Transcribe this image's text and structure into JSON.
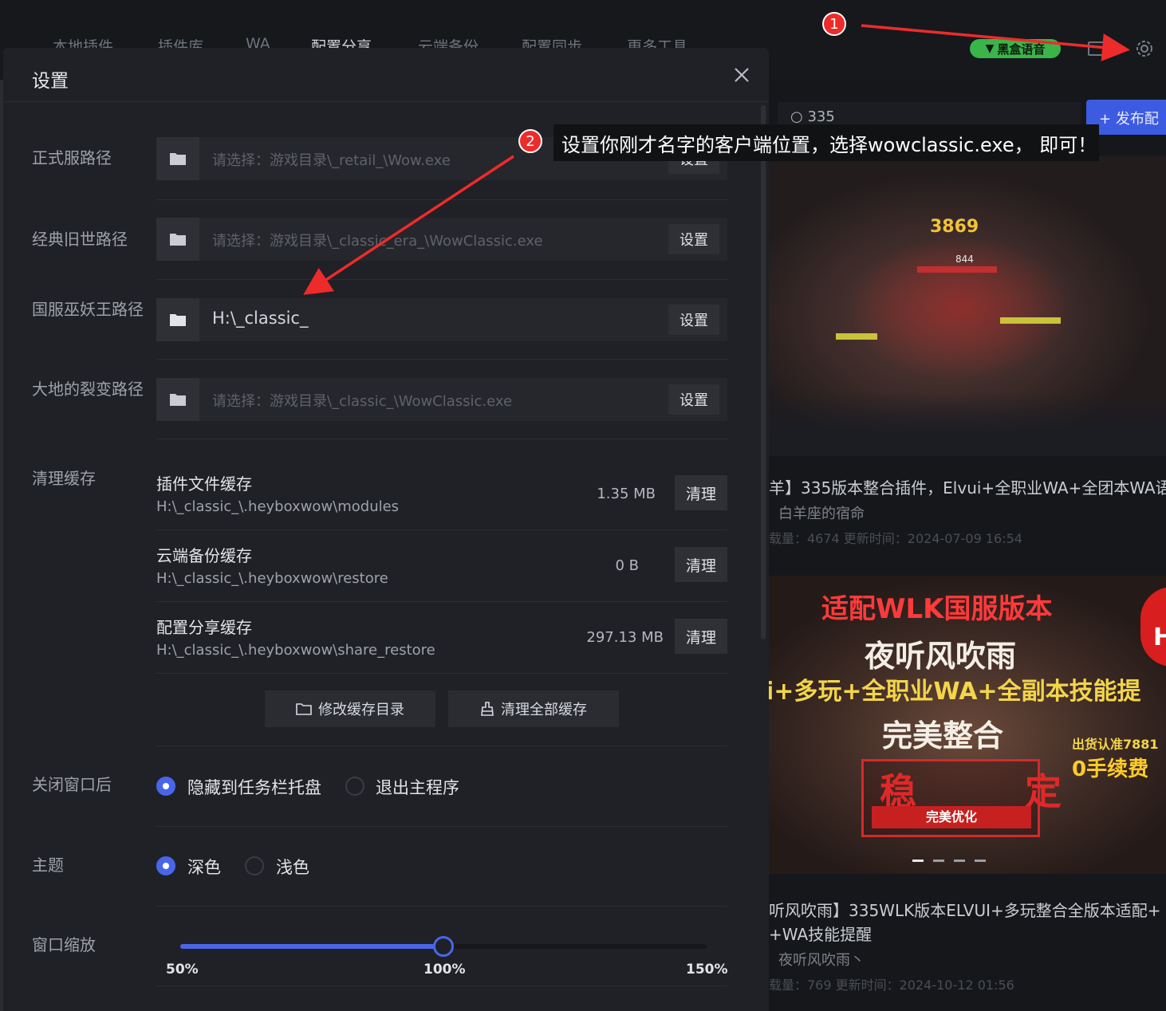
{
  "topnav": {
    "tabs": [
      "本地插件",
      "插件库",
      "WA",
      "配置分享",
      "云端备份",
      "配置同步",
      "更多工具"
    ],
    "active_tab": "配置分享",
    "voice_badge": "黑盒语音"
  },
  "main": {
    "search_value": "335",
    "publish_label": "发布配",
    "cards": [
      {
        "title": "羊】335版本整合插件，Elvui+全职业WA+全团本WA语",
        "author": "白羊座的宿命",
        "meta": "载量：4674    更新时间：2024-07-09 16:54",
        "image_numbers": [
          "3869",
          "844"
        ]
      },
      {
        "title": "听风吹雨】335WLK版本ELVUI+多玩整合全版本适配+",
        "title_line2": "+WA技能提醒",
        "author": "夜听风吹雨丶",
        "meta": "载量：769    更新时间：2024-10-12 01:56",
        "image_texts": [
          "适配WLK国服版本",
          "夜听风吹雨",
          "i+多玩+全职业WA+全副本技能提",
          "完美整合",
          "出货认准7881",
          "0手续费",
          "稳  定",
          "完美优化",
          "H"
        ]
      }
    ]
  },
  "dialog": {
    "title": "设置",
    "paths": [
      {
        "label": "正式服路径",
        "value": "",
        "placeholder": "请选择：游戏目录\\_retail_\\Wow.exe",
        "button": "设置"
      },
      {
        "label": "经典旧世路径",
        "value": "",
        "placeholder": "请选择：游戏目录\\_classic_era_\\WowClassic.exe",
        "button": "设置"
      },
      {
        "label": "国服巫妖王路径",
        "value": "H:\\_classic_",
        "placeholder": "",
        "button": "设置"
      },
      {
        "label": "大地的裂变路径",
        "value": "",
        "placeholder": "请选择：游戏目录\\_classic_\\WowClassic.exe",
        "button": "设置"
      }
    ],
    "cache": {
      "label": "清理缓存",
      "items": [
        {
          "title": "插件文件缓存",
          "path": "H:\\_classic_\\.heyboxwow\\modules",
          "size": "1.35 MB",
          "button": "清理"
        },
        {
          "title": "云端备份缓存",
          "path": "H:\\_classic_\\.heyboxwow\\restore",
          "size": "0 B",
          "button": "清理"
        },
        {
          "title": "配置分享缓存",
          "path": "H:\\_classic_\\.heyboxwow\\share_restore",
          "size": "297.13 MB",
          "button": "清理"
        }
      ],
      "modify_dir_label": "修改缓存目录",
      "clear_all_label": "清理全部缓存"
    },
    "close_behavior": {
      "label": "关闭窗口后",
      "options": [
        "隐藏到任务栏托盘",
        "退出主程序"
      ],
      "selected": 0
    },
    "theme": {
      "label": "主题",
      "options": [
        "深色",
        "浅色"
      ],
      "selected": 0
    },
    "zoom": {
      "label": "窗口缩放",
      "ticks": [
        "50%",
        "100%",
        "150%"
      ],
      "min": 50,
      "max": 150,
      "value": 100
    }
  },
  "annotations": {
    "step1": "1",
    "step2": "2",
    "step2_text": "设置你刚才名字的客户端位置，选择wowclassic.exe， 即可！",
    "color": "#ee2b2b"
  }
}
